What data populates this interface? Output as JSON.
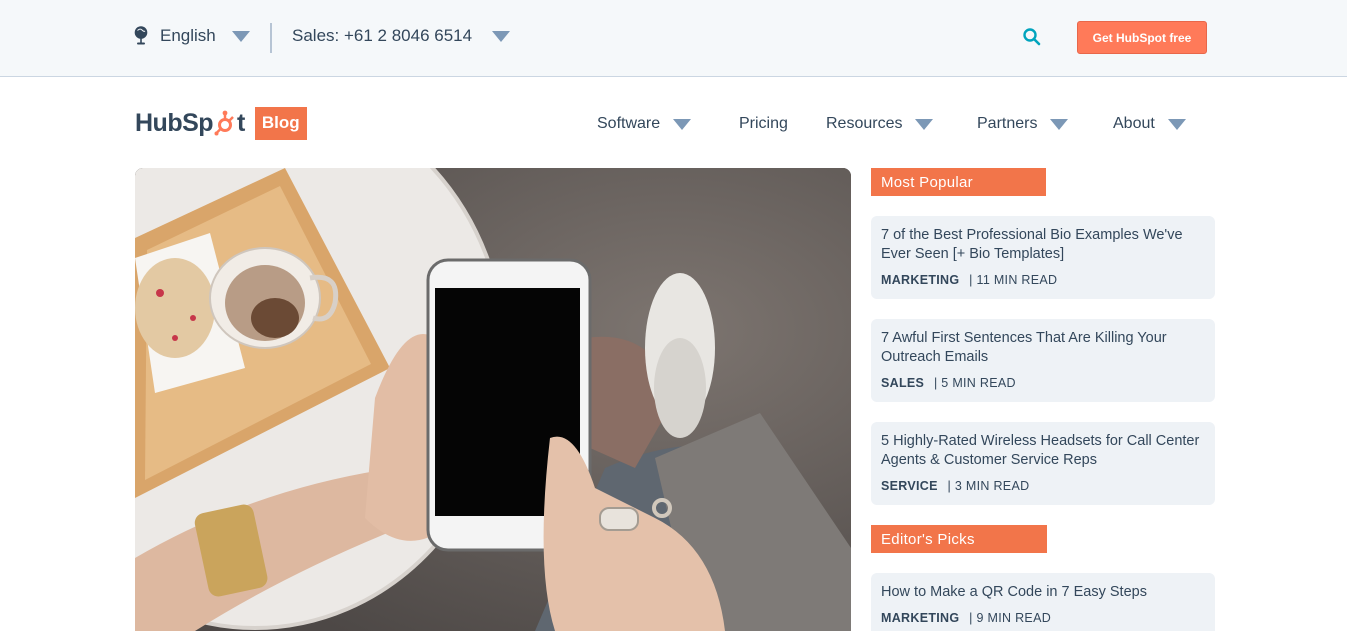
{
  "utility": {
    "language": "English",
    "sales": "Sales: +61 2 8046 6514",
    "cta": "Get HubSpot free"
  },
  "brand": {
    "logo_text_left": "HubSp",
    "logo_text_right": "t",
    "badge": "Blog"
  },
  "nav": {
    "items": [
      {
        "label": "Software",
        "dropdown": true
      },
      {
        "label": "Pricing",
        "dropdown": false
      },
      {
        "label": "Resources",
        "dropdown": true
      },
      {
        "label": "Partners",
        "dropdown": true
      },
      {
        "label": "About",
        "dropdown": true
      }
    ]
  },
  "sidebar": {
    "most_popular_label": "Most Popular",
    "editors_picks_label": "Editor's Picks",
    "popular": [
      {
        "title": "7 of the Best Professional Bio Examples We've Ever Seen [+ Bio Templates]",
        "category": "MARKETING",
        "read": "| 11 MIN READ"
      },
      {
        "title": "7 Awful First Sentences That Are Killing Your Outreach Emails",
        "category": "SALES",
        "read": "| 5 MIN READ"
      },
      {
        "title": "5 Highly-Rated Wireless Headsets for Call Center Agents & Customer Service Reps",
        "category": "SERVICE",
        "read": "| 3 MIN READ"
      }
    ],
    "picks": [
      {
        "title": "How to Make a QR Code in 7 Easy Steps",
        "category": "MARKETING",
        "read": "| 9 MIN READ"
      }
    ]
  },
  "colors": {
    "accent": "#ff7a59",
    "label_orange": "#f2754a",
    "text": "#33475b",
    "caret": "#7c98b6",
    "search": "#00a4bd",
    "card_bg": "#eef2f6"
  },
  "icons": [
    "globe-icon",
    "chevron-down-icon",
    "search-icon",
    "sprocket-icon"
  ]
}
